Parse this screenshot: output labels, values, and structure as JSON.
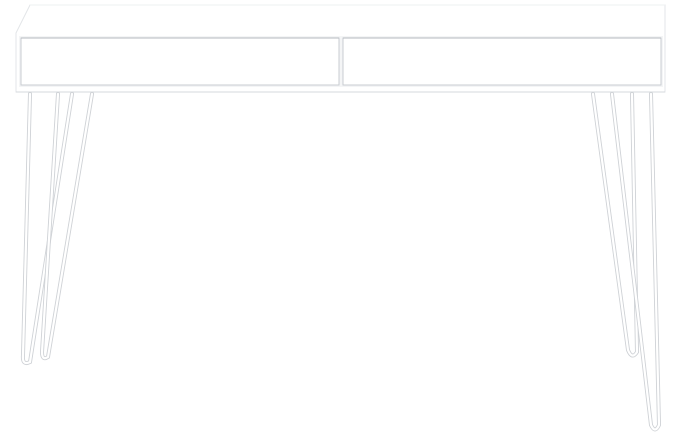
{
  "image": {
    "subject": "white-desk",
    "colors": {
      "background": "#ffffff",
      "desk_top": "#ffffff",
      "desk_edge": "#e3e5e8",
      "drawer_face": "#ffffff",
      "drawer_line": "#c9ccd1",
      "shadow": "#eef0f2",
      "leg": "#ffffff",
      "leg_outline": "#cfd2d6"
    }
  }
}
